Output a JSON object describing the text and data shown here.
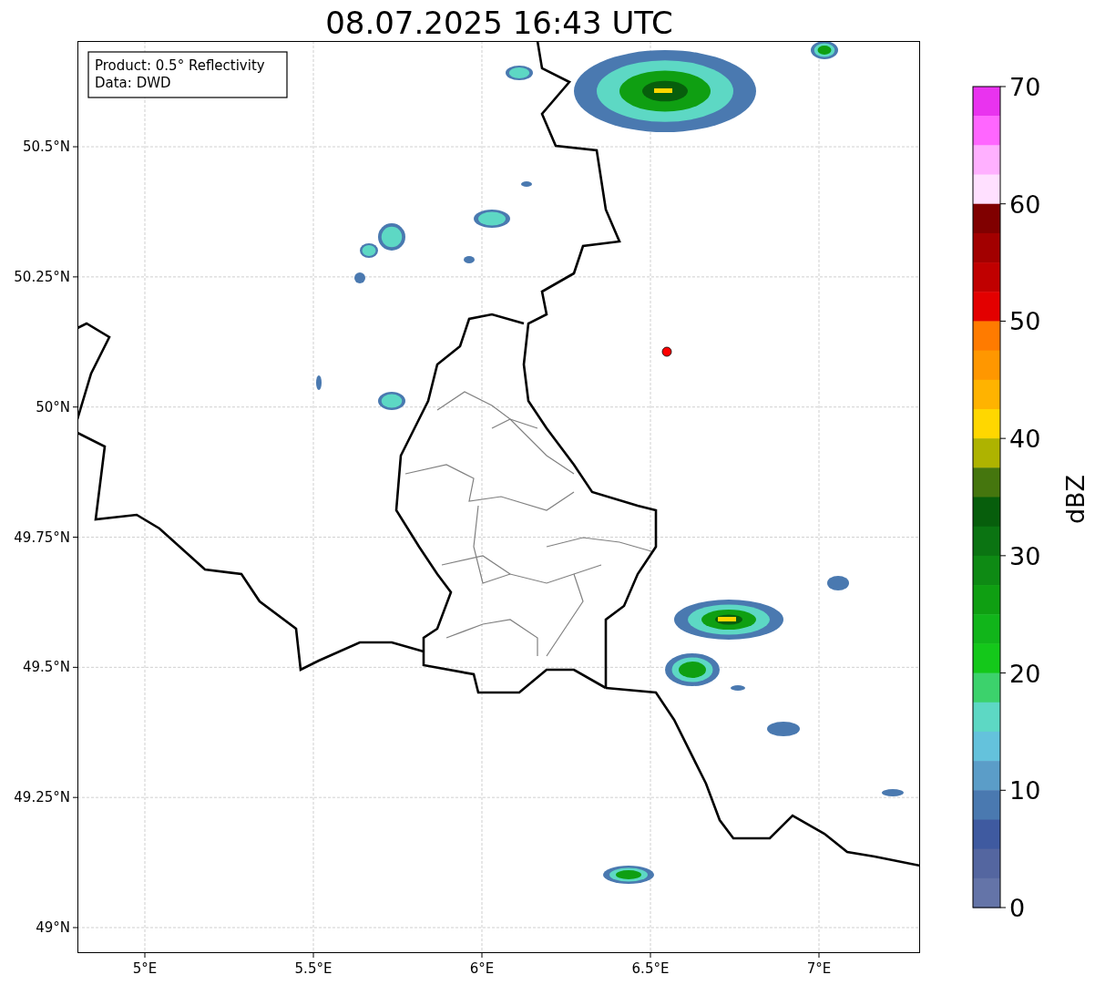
{
  "title": "08.07.2025 16:43 UTC",
  "info_box": {
    "lines": [
      "Product: 0.5° Reflectivity",
      "Data: DWD"
    ]
  },
  "map": {
    "x_ticks": [
      "5°E",
      "5.5°E",
      "6°E",
      "6.5°E",
      "7°E"
    ],
    "y_ticks": [
      "50.5°N",
      "50.25°N",
      "50°N",
      "49.75°N",
      "49.5°N",
      "49.25°N",
      "49°N"
    ]
  },
  "colorbar": {
    "label": "dBZ",
    "ticks": [
      "70",
      "60",
      "50",
      "40",
      "30",
      "20",
      "10",
      "0"
    ],
    "bands": [
      {
        "color": "#e933ef"
      },
      {
        "color": "#ff66ff"
      },
      {
        "color": "#ffb0ff"
      },
      {
        "color": "#ffe0ff"
      },
      {
        "color": "#800000"
      },
      {
        "color": "#a20000"
      },
      {
        "color": "#c00000"
      },
      {
        "color": "#e30000"
      },
      {
        "color": "#ff7b00"
      },
      {
        "color": "#ff9700"
      },
      {
        "color": "#ffb300"
      },
      {
        "color": "#ffd700"
      },
      {
        "color": "#aeb300"
      },
      {
        "color": "#45760e"
      },
      {
        "color": "#075e0c"
      },
      {
        "color": "#0b7412"
      },
      {
        "color": "#0e8a14"
      },
      {
        "color": "#0f9f12"
      },
      {
        "color": "#11b51a"
      },
      {
        "color": "#14c81a"
      },
      {
        "color": "#3cd26c"
      },
      {
        "color": "#5dd8c4"
      },
      {
        "color": "#64c2dc"
      },
      {
        "color": "#5b9dc8"
      },
      {
        "color": "#4a79b0"
      },
      {
        "color": "#3f5aa0"
      },
      {
        "color": "#5466a0"
      },
      {
        "color": "#6474a8"
      }
    ]
  }
}
